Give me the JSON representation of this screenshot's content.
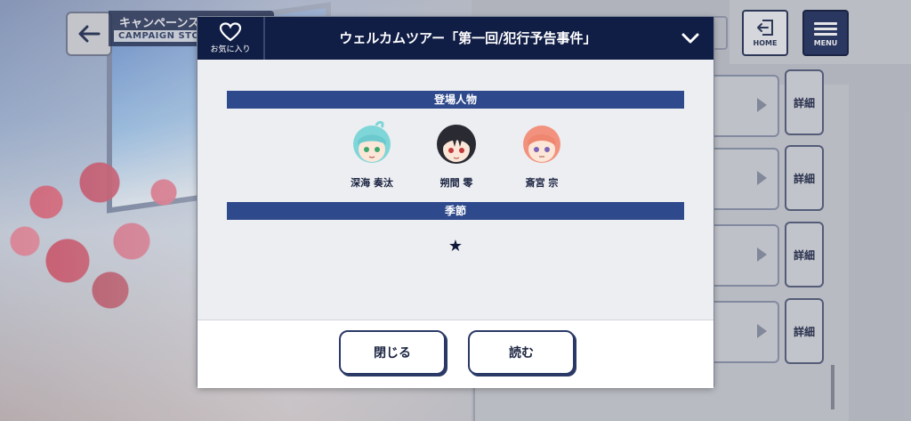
{
  "header": {
    "back_icon": "arrow-left-icon",
    "screen_title_jp": "キャンペーンスト",
    "screen_title_en": "CAMPAIGN STO",
    "home_label": "HOME",
    "menu_label": "MENU"
  },
  "list": {
    "detail_label": "詳細",
    "rows": [
      {
        "detail": "詳細"
      },
      {
        "detail": "詳細"
      },
      {
        "detail": "詳細"
      },
      {
        "detail": "詳細"
      }
    ]
  },
  "dialog": {
    "favorite_label": "お気に入り",
    "title": "ウェルカムツアー「第一回/犯行予告事件」",
    "characters_heading": "登場人物",
    "characters": [
      {
        "name": "深海 奏汰",
        "hair": "#7fd6d9",
        "eyes": "#3aa86a"
      },
      {
        "name": "朔間 零",
        "hair": "#2a2a33",
        "eyes": "#c23a3a"
      },
      {
        "name": "斎宮 宗",
        "hair": "#f2927e",
        "eyes": "#7d63b5"
      }
    ],
    "season_heading": "季節",
    "season_value": "★",
    "close_label": "閉じる",
    "read_label": "読む"
  },
  "colors": {
    "header_navy": "#101d45",
    "section_blue": "#2e4a8c",
    "button_navy": "#2b3966"
  }
}
